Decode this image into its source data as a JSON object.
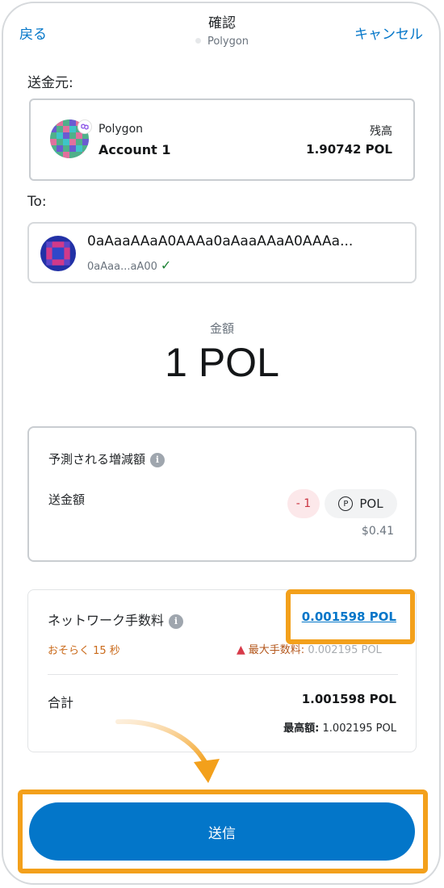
{
  "header": {
    "back_label": "戻る",
    "title": "確認",
    "network": "Polygon",
    "cancel_label": "キャンセル"
  },
  "from": {
    "label": "送金元:",
    "network": "Polygon",
    "account": "Account 1",
    "balance_label": "残高",
    "balance": "1.90742 POL"
  },
  "to": {
    "label": "To:",
    "address": "0aAaaAAaA0AAAa0aAaaAAaA0AAAa...",
    "short_address": "0aAaa...aA00"
  },
  "amount": {
    "label": "金額",
    "value": "1 POL"
  },
  "estimated": {
    "title": "予測される増減額",
    "send_label": "送金額",
    "change": "- 1",
    "token": "POL",
    "token_icon_letter": "P",
    "fiat": "$0.41"
  },
  "fee": {
    "title": "ネットワーク手数料",
    "value": "0.001598 POL",
    "eta": "おそらく 15 秒",
    "max_label": "最大手数料:",
    "max_value": "0.002195 POL",
    "total_label": "合計",
    "total_value": "1.001598 POL",
    "max_total_label": "最高額:",
    "max_total_value": "1.002195 POL"
  },
  "send_button_label": "送信",
  "colors": {
    "accent": "#0376c9",
    "highlight": "#f3a01b",
    "negative": "#ca3542",
    "warning": "#d73a49"
  }
}
